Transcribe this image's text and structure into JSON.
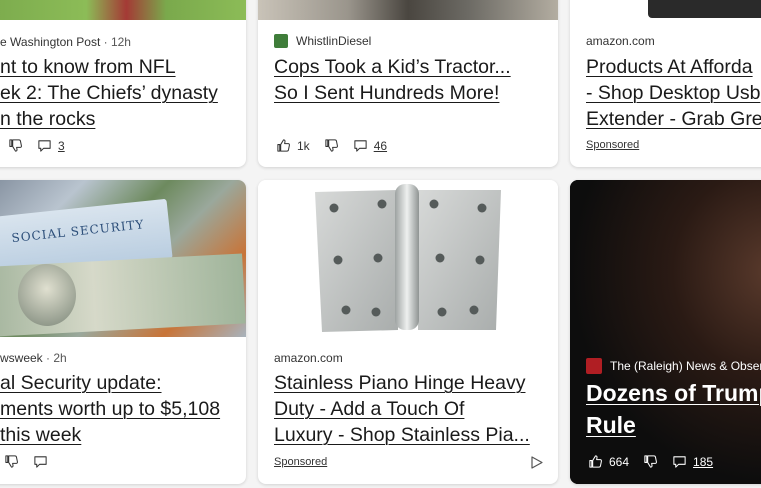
{
  "cards": {
    "c1": {
      "source": "e Washington Post",
      "time": "· 12h",
      "lines": [
        "nt to know from NFL",
        "ek 2: The Chiefs’ dynasty",
        "n the rocks"
      ],
      "comments": "3"
    },
    "c2": {
      "source": "WhistlinDiesel",
      "lines": [
        "Cops Took a Kid’s Tractor...",
        "So I Sent Hundreds More!"
      ],
      "likes": "1k",
      "comments": "46"
    },
    "c3": {
      "source": "amazon.com",
      "lines": [
        "Products At Afforda",
        "- Shop Desktop Usb",
        "Extender - Grab Gre"
      ],
      "sponsored": "Sponsored"
    },
    "c4": {
      "source": "wsweek",
      "time": "· 2h",
      "lines": [
        "al Security update:",
        "ments worth up to $5,108",
        "this week"
      ],
      "image_text": "SOCIAL SECURITY"
    },
    "c5": {
      "source": "amazon.com",
      "lines": [
        "Stainless Piano Hinge Heavy",
        "Duty - Add a Touch Of",
        "Luxury - Shop Stainless Pia..."
      ],
      "sponsored": "Sponsored"
    },
    "c6": {
      "source": "The (Raleigh) News & Observ",
      "lines": [
        "Dozens of Trump",
        "Rule"
      ],
      "likes": "664",
      "comments": "185"
    }
  },
  "colors": {
    "whistlin": "#3f7d3a",
    "raleigh": "#b01e23",
    "card_bg": "#ffffff",
    "page_bg": "#f4f4f4"
  },
  "icons": [
    "thumbs-up-icon",
    "thumbs-down-icon",
    "comment-icon",
    "ad-choices-icon"
  ]
}
